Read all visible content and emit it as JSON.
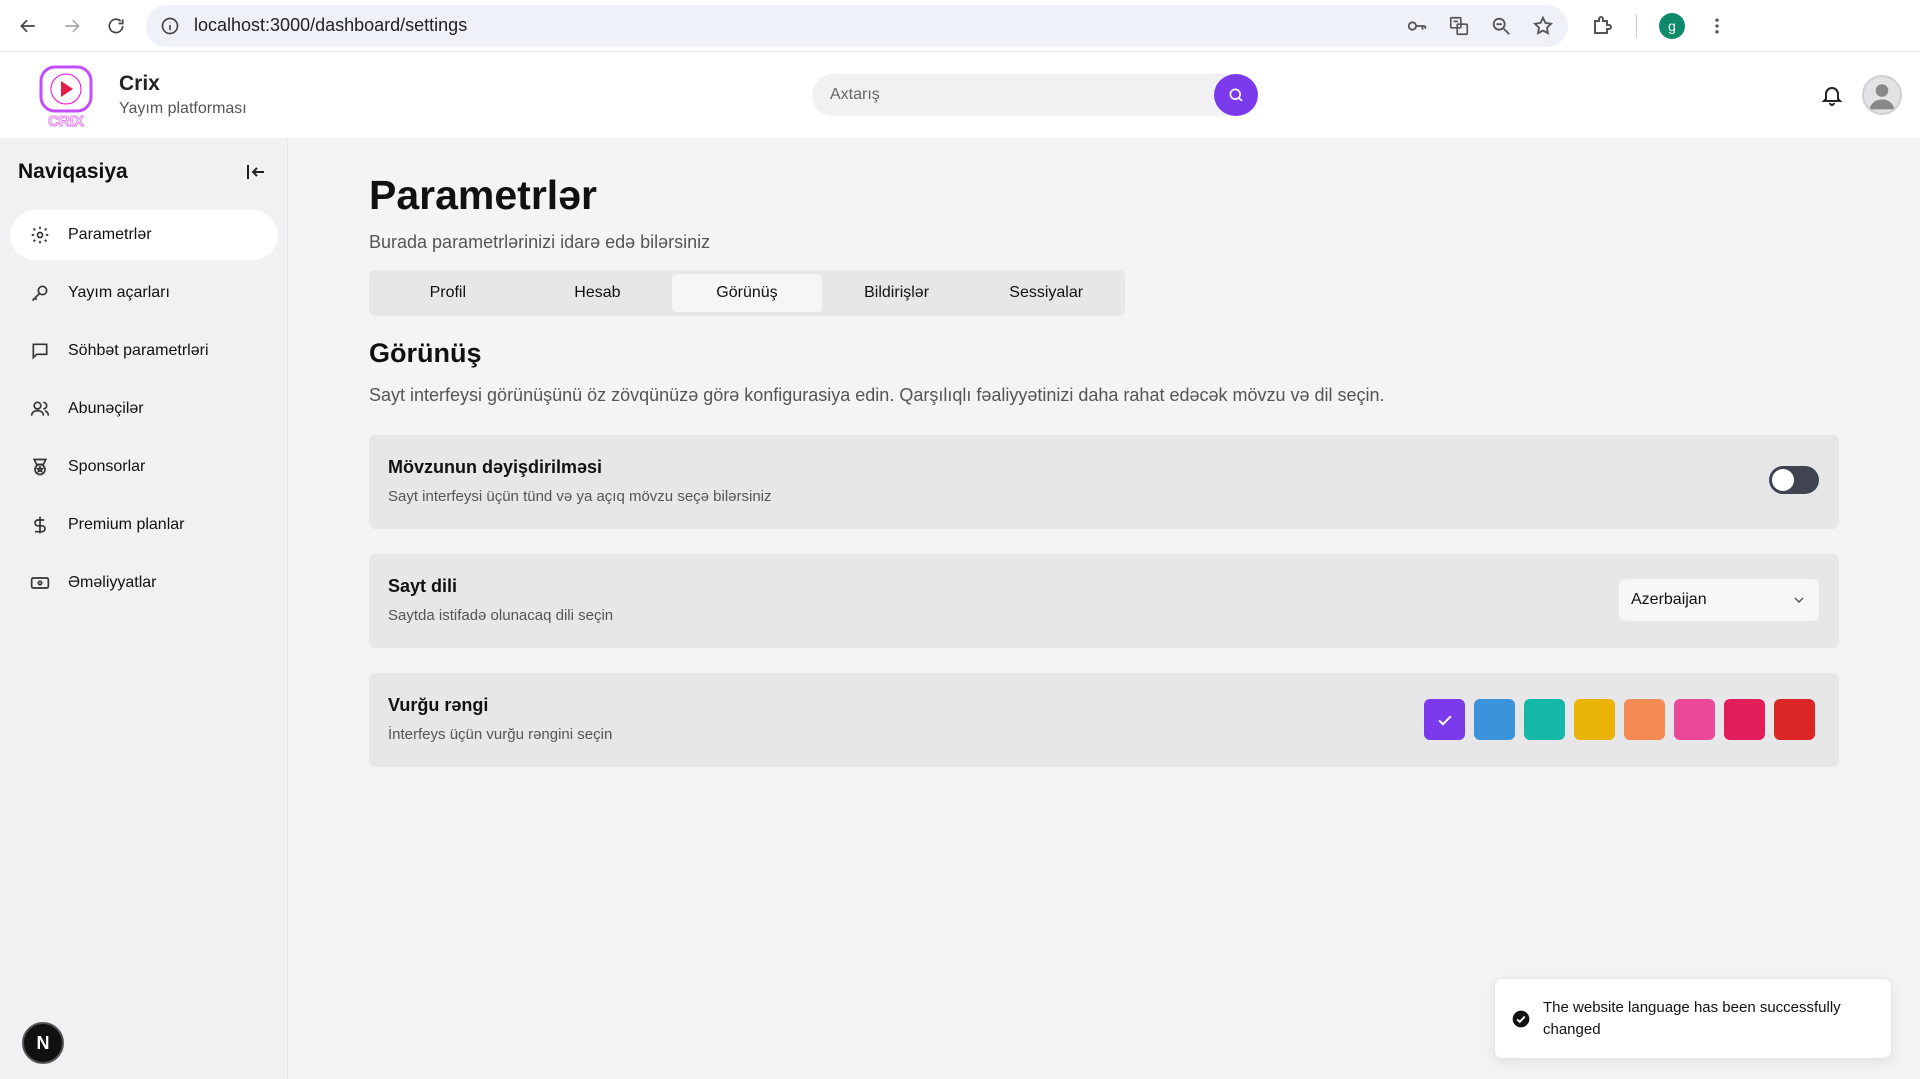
{
  "browser": {
    "url": "localhost:3000/dashboard/settings",
    "profile_initial": "g"
  },
  "header": {
    "brand_name": "Crix",
    "brand_subtitle": "Yayım platforması",
    "logo_text": "CRIX",
    "search_placeholder": "Axtarış"
  },
  "sidebar": {
    "title": "Naviqasiya",
    "items": [
      {
        "label": "Parametrlər",
        "icon": "gear-icon",
        "active": true
      },
      {
        "label": "Yayım açarları",
        "icon": "key-icon",
        "active": false
      },
      {
        "label": "Söhbət parametrləri",
        "icon": "chat-icon",
        "active": false
      },
      {
        "label": "Abunəçilər",
        "icon": "users-icon",
        "active": false
      },
      {
        "label": "Sponsorlar",
        "icon": "medal-icon",
        "active": false
      },
      {
        "label": "Premium planlar",
        "icon": "dollar-icon",
        "active": false
      },
      {
        "label": "Əməliyyatlar",
        "icon": "banknote-icon",
        "active": false
      }
    ],
    "badge": "N"
  },
  "main": {
    "title": "Parametrlər",
    "subtitle": "Burada parametrlərinizi idarə edə bilərsiniz",
    "tabs": [
      {
        "label": "Profil",
        "active": false
      },
      {
        "label": "Hesab",
        "active": false
      },
      {
        "label": "Görünüş",
        "active": true
      },
      {
        "label": "Bildirişlər",
        "active": false
      },
      {
        "label": "Sessiyalar",
        "active": false
      }
    ],
    "section_title": "Görünüş",
    "section_desc": "Sayt interfeysi görünüşünü öz zövqünüzə görə konfigurasiya edin. Qarşılıqlı fəaliyyətinizi daha rahat edəcək mövzu və dil seçin.",
    "theme_card": {
      "title": "Mövzunun dəyişdirilməsi",
      "desc": "Sayt interfeysi üçün tünd və ya açıq mövzu seçə bilərsiniz",
      "toggle_on": false
    },
    "language_card": {
      "title": "Sayt dili",
      "desc": "Saytda istifadə olunacaq dili seçin",
      "selected": "Azerbaijan"
    },
    "accent_card": {
      "title": "Vurğu rəngi",
      "desc": "İnterfeys üçün vurğu rəngini seçin",
      "colors": [
        "#7c3aed",
        "#3b93db",
        "#14b8a6",
        "#eab308",
        "#f58a52",
        "#ec4899",
        "#e11d5a",
        "#dc2626"
      ],
      "selected_index": 0
    }
  },
  "toast": {
    "message": "The website language has been successfully changed"
  },
  "colors": {
    "accent": "#7c3aed"
  }
}
